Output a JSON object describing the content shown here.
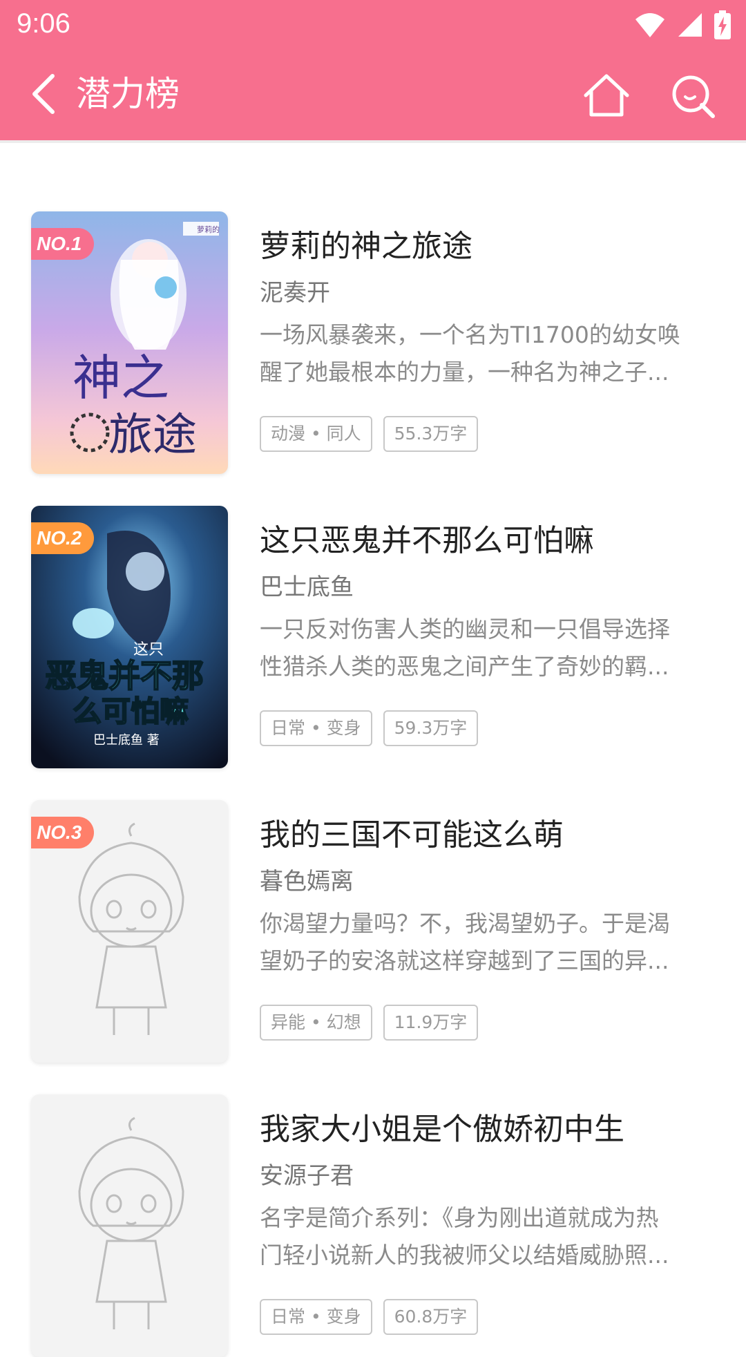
{
  "status_bar": {
    "time": "9:06"
  },
  "header": {
    "title": "潜力榜"
  },
  "colors": {
    "accent": "#f76f8e",
    "rank1": "#f76f8e",
    "rank2": "#ff9a3c",
    "rank3": "#ff7f6a"
  },
  "books": [
    {
      "rank": "NO.1",
      "title": "萝莉的神之旅途",
      "author": "泥奏开",
      "desc_line1": "一场风暴袭来，一个名为TI1700的幼女唤",
      "desc_line2": "醒了她最根本的力量，一种名为神之子...",
      "category": "动漫 • 同人",
      "words": "55.3万字",
      "cover_title_top": "神之",
      "cover_title_bottom": "旅途",
      "cover_badge": "萝莉的"
    },
    {
      "rank": "NO.2",
      "title": "这只恶鬼并不那么可怕嘛",
      "author": "巴士底鱼",
      "desc_line1": "一只反对伤害人类的幽灵和一只倡导选择",
      "desc_line2": "性猎杀人类的恶鬼之间产生了奇妙的羁...",
      "category": "日常 • 变身",
      "words": "59.3万字",
      "cover_title_top": "这只",
      "cover_title_mid": "恶鬼并不那",
      "cover_title_bottom": "么可怕嘛",
      "cover_author": "巴士底鱼 著"
    },
    {
      "rank": "NO.3",
      "title": "我的三国不可能这么萌",
      "author": "暮色嫣离",
      "desc_line1": "你渴望力量吗？不，我渴望奶子。于是渴",
      "desc_line2": "望奶子的安洛就这样穿越到了三国的异...",
      "category": "异能 • 幻想",
      "words": "11.9万字"
    },
    {
      "rank": "",
      "title": "我家大小姐是个傲娇初中生",
      "author": "安源子君",
      "desc_line1": "名字是简介系列：《身为刚出道就成为热",
      "desc_line2": "门轻小说新人的我被师父以结婚威胁照...",
      "category": "日常 • 变身",
      "words": "60.8万字"
    }
  ]
}
